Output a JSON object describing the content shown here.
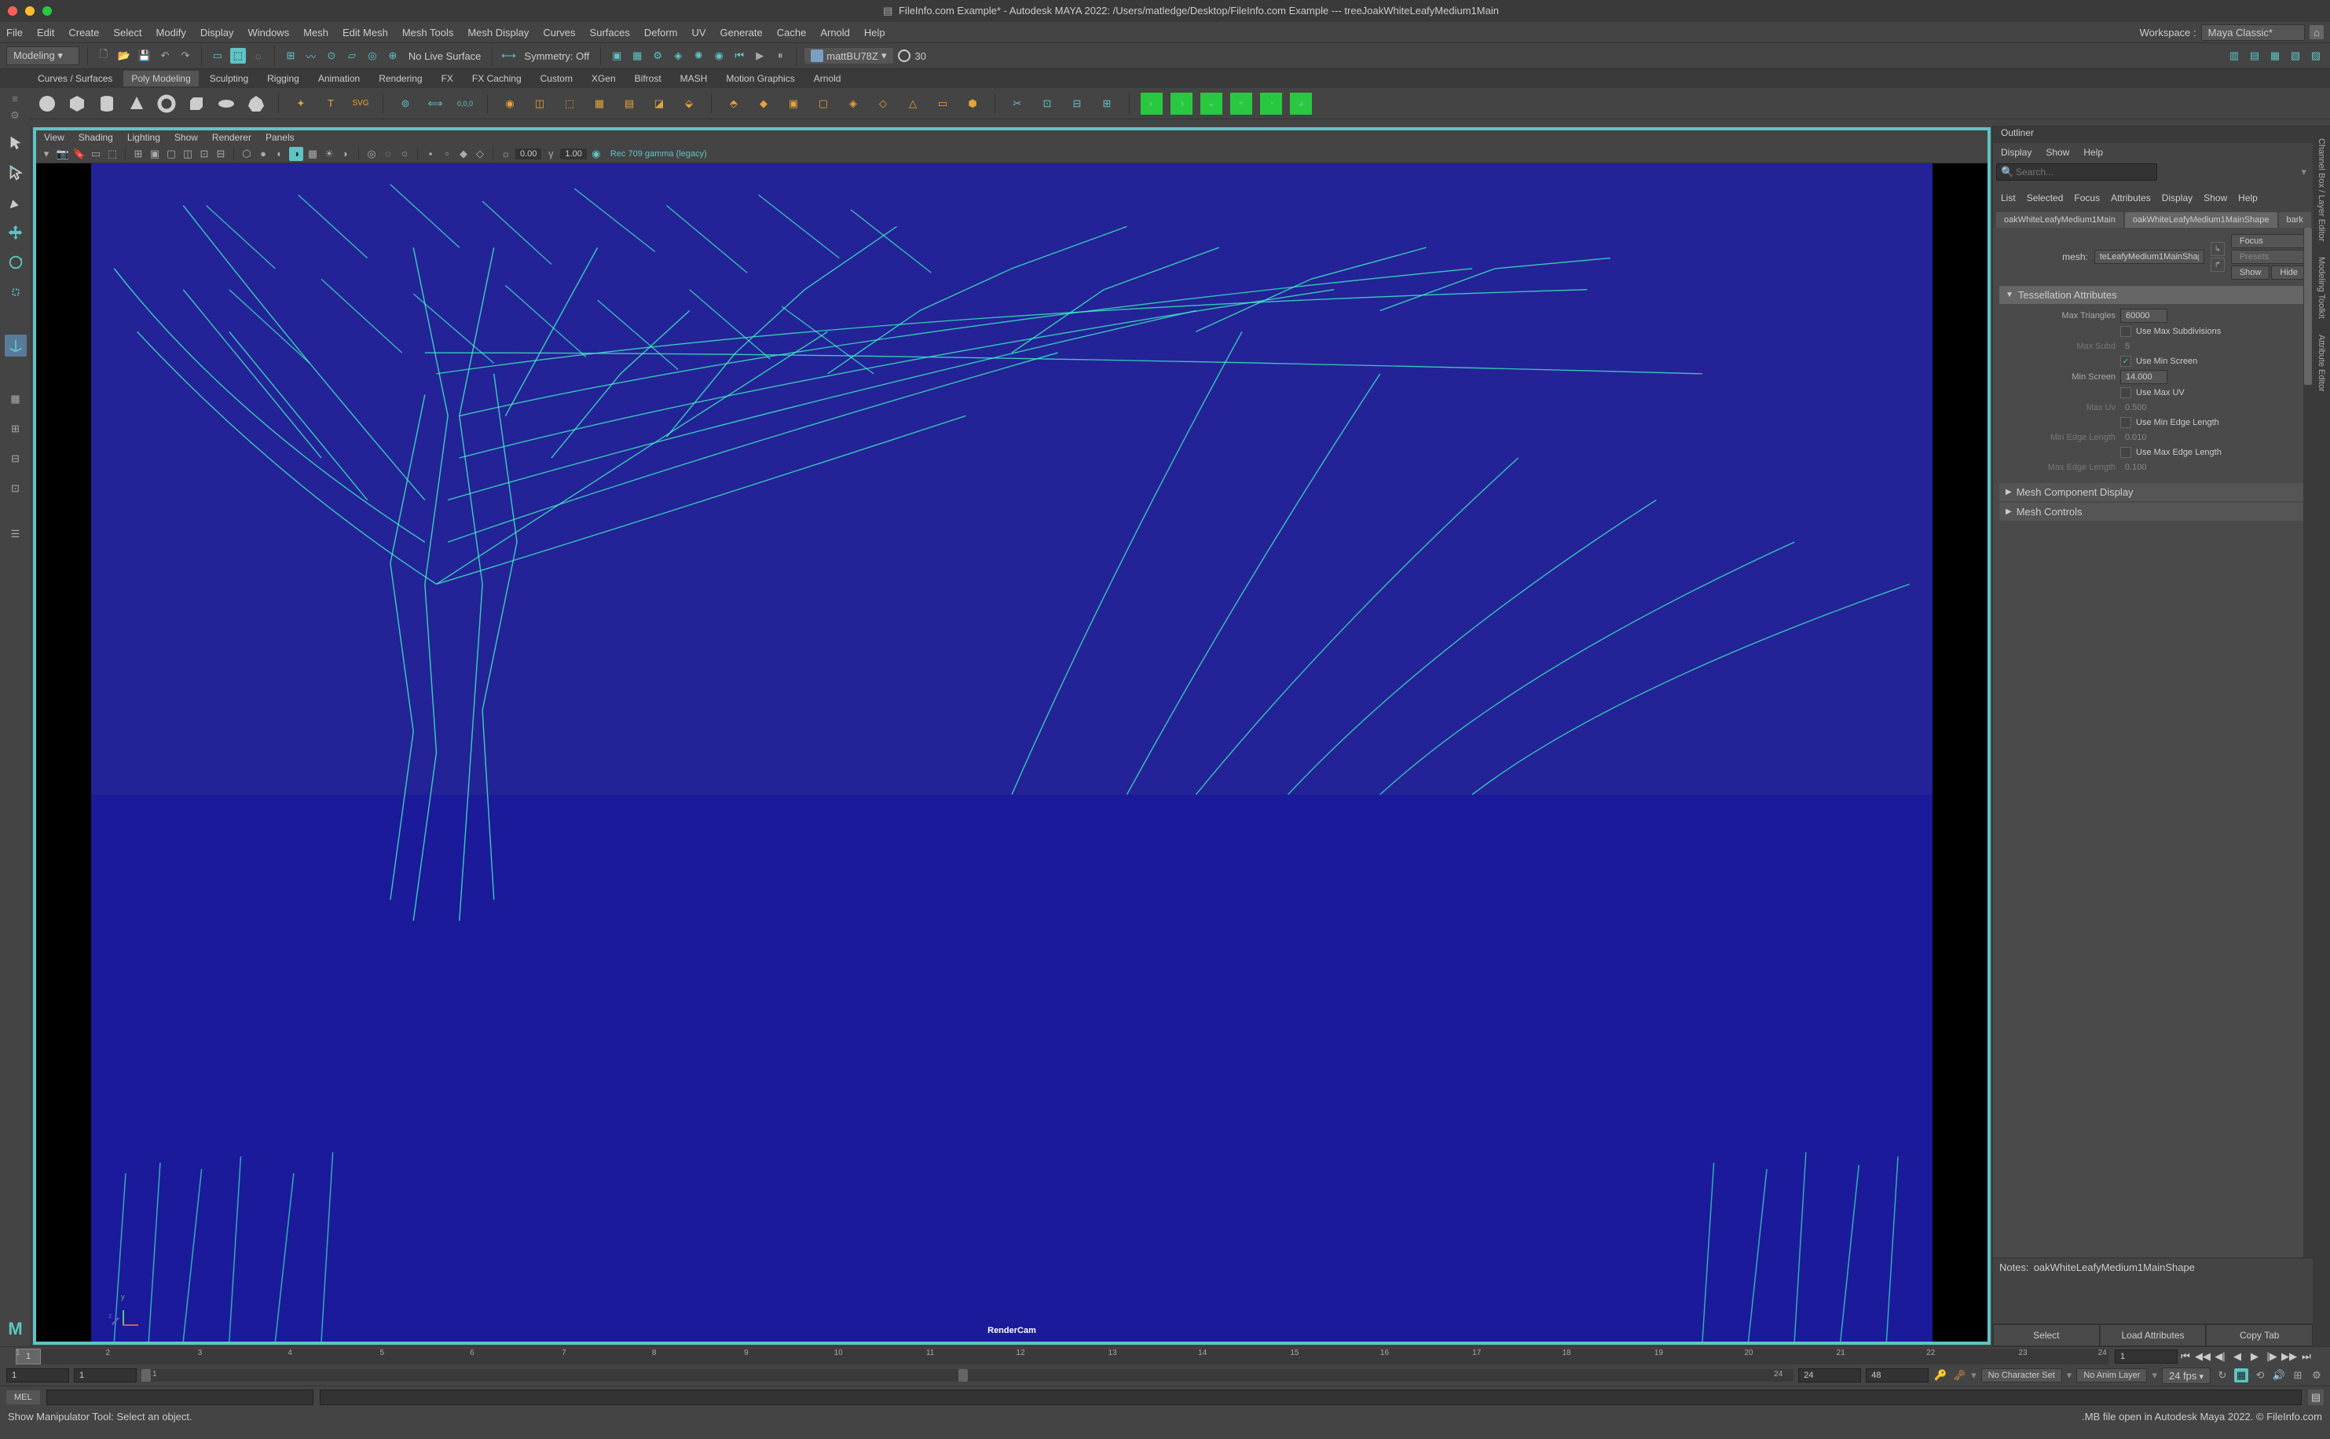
{
  "title": "FileInfo.com Example* - Autodesk MAYA 2022: /Users/matledge/Desktop/FileInfo.com Example  ---  treeJoakWhiteLeafyMedium1Main",
  "mainMenu": [
    "File",
    "Edit",
    "Create",
    "Select",
    "Modify",
    "Display",
    "Windows",
    "Mesh",
    "Edit Mesh",
    "Mesh Tools",
    "Mesh Display",
    "Curves",
    "Surfaces",
    "Deform",
    "UV",
    "Generate",
    "Cache",
    "Arnold",
    "Help"
  ],
  "workspace": {
    "label": "Workspace :",
    "value": "Maya Classic*"
  },
  "toolbar": {
    "mode": "Modeling",
    "liveSurface": "No Live Surface",
    "symmetry": "Symmetry: Off",
    "user": "mattBU78Z",
    "timeValue": "30"
  },
  "shelfTabs": [
    "Curves / Surfaces",
    "Poly Modeling",
    "Sculpting",
    "Rigging",
    "Animation",
    "Rendering",
    "FX",
    "FX Caching",
    "Custom",
    "XGen",
    "Bifrost",
    "MASH",
    "Motion Graphics",
    "Arnold"
  ],
  "viewportMenu": [
    "View",
    "Shading",
    "Lighting",
    "Show",
    "Renderer",
    "Panels"
  ],
  "viewportToolbar": {
    "exposure": "0.00",
    "gamma": "1.00",
    "colorspace": "Rec 709 gamma (legacy)"
  },
  "viewport": {
    "camera": "RenderCam",
    "axisY": "y",
    "axisZ": "z"
  },
  "outliner": {
    "title": "Outliner",
    "menu": [
      "Display",
      "Show",
      "Help"
    ],
    "searchPlaceholder": "Search..."
  },
  "attributeEditor": {
    "menu": [
      "List",
      "Selected",
      "Focus",
      "Attributes",
      "Display",
      "Show",
      "Help"
    ],
    "tabs": [
      "oakWhiteLeafyMedium1Main",
      "oakWhiteLeafyMedium1MainShape",
      "bark"
    ],
    "meshLabel": "mesh:",
    "meshValue": "teLeafyMedium1MainShape",
    "buttons": {
      "focus": "Focus",
      "presets": "Presets",
      "show": "Show",
      "hide": "Hide"
    },
    "tessellation": {
      "header": "Tessellation Attributes",
      "maxTrianglesLabel": "Max Triangles",
      "maxTriangles": "60000",
      "useMaxSubd": "Use Max Subdivisions",
      "maxSubdLabel": "Max Subd",
      "maxSubd": "5",
      "useMinScreen": "Use Min Screen",
      "minScreenLabel": "Min Screen",
      "minScreen": "14.000",
      "useMaxUV": "Use Max UV",
      "maxUVLabel": "Max Uv",
      "maxUV": "0.500",
      "useMinEdge": "Use Min Edge Length",
      "minEdgeLabel": "Min Edge Length",
      "minEdge": "0.010",
      "useMaxEdge": "Use Max Edge Length",
      "maxEdgeLabel": "Max Edge Length",
      "maxEdge": "0.100"
    },
    "sections": {
      "meshComponent": "Mesh Component Display",
      "meshControls": "Mesh Controls"
    },
    "notesLabel": "Notes:",
    "notesValue": "oakWhiteLeafyMedium1MainShape",
    "footer": {
      "select": "Select",
      "load": "Load Attributes",
      "copy": "Copy Tab"
    }
  },
  "sideTabs": [
    "Channel Box / Layer Editor",
    "Modeling Toolkit",
    "Attribute Editor"
  ],
  "timeline": {
    "ticks": [
      "1",
      "2",
      "3",
      "4",
      "5",
      "6",
      "7",
      "8",
      "9",
      "10",
      "11",
      "12",
      "13",
      "14",
      "15",
      "16",
      "17",
      "18",
      "19",
      "20",
      "21",
      "22",
      "23",
      "24"
    ],
    "current": "1",
    "frameInput": "1"
  },
  "range": {
    "startOuter": "1",
    "startInner": "1",
    "startLabel": "1",
    "endLabel": "24",
    "endInner": "24",
    "endOuter": "48",
    "charSet": "No Character Set",
    "animLayer": "No Anim Layer",
    "fps": "24 fps"
  },
  "cmdline": {
    "label": "MEL"
  },
  "status": {
    "left": "Show Manipulator Tool: Select an object.",
    "right": ".MB file open in Autodesk Maya 2022. © FileInfo.com"
  }
}
